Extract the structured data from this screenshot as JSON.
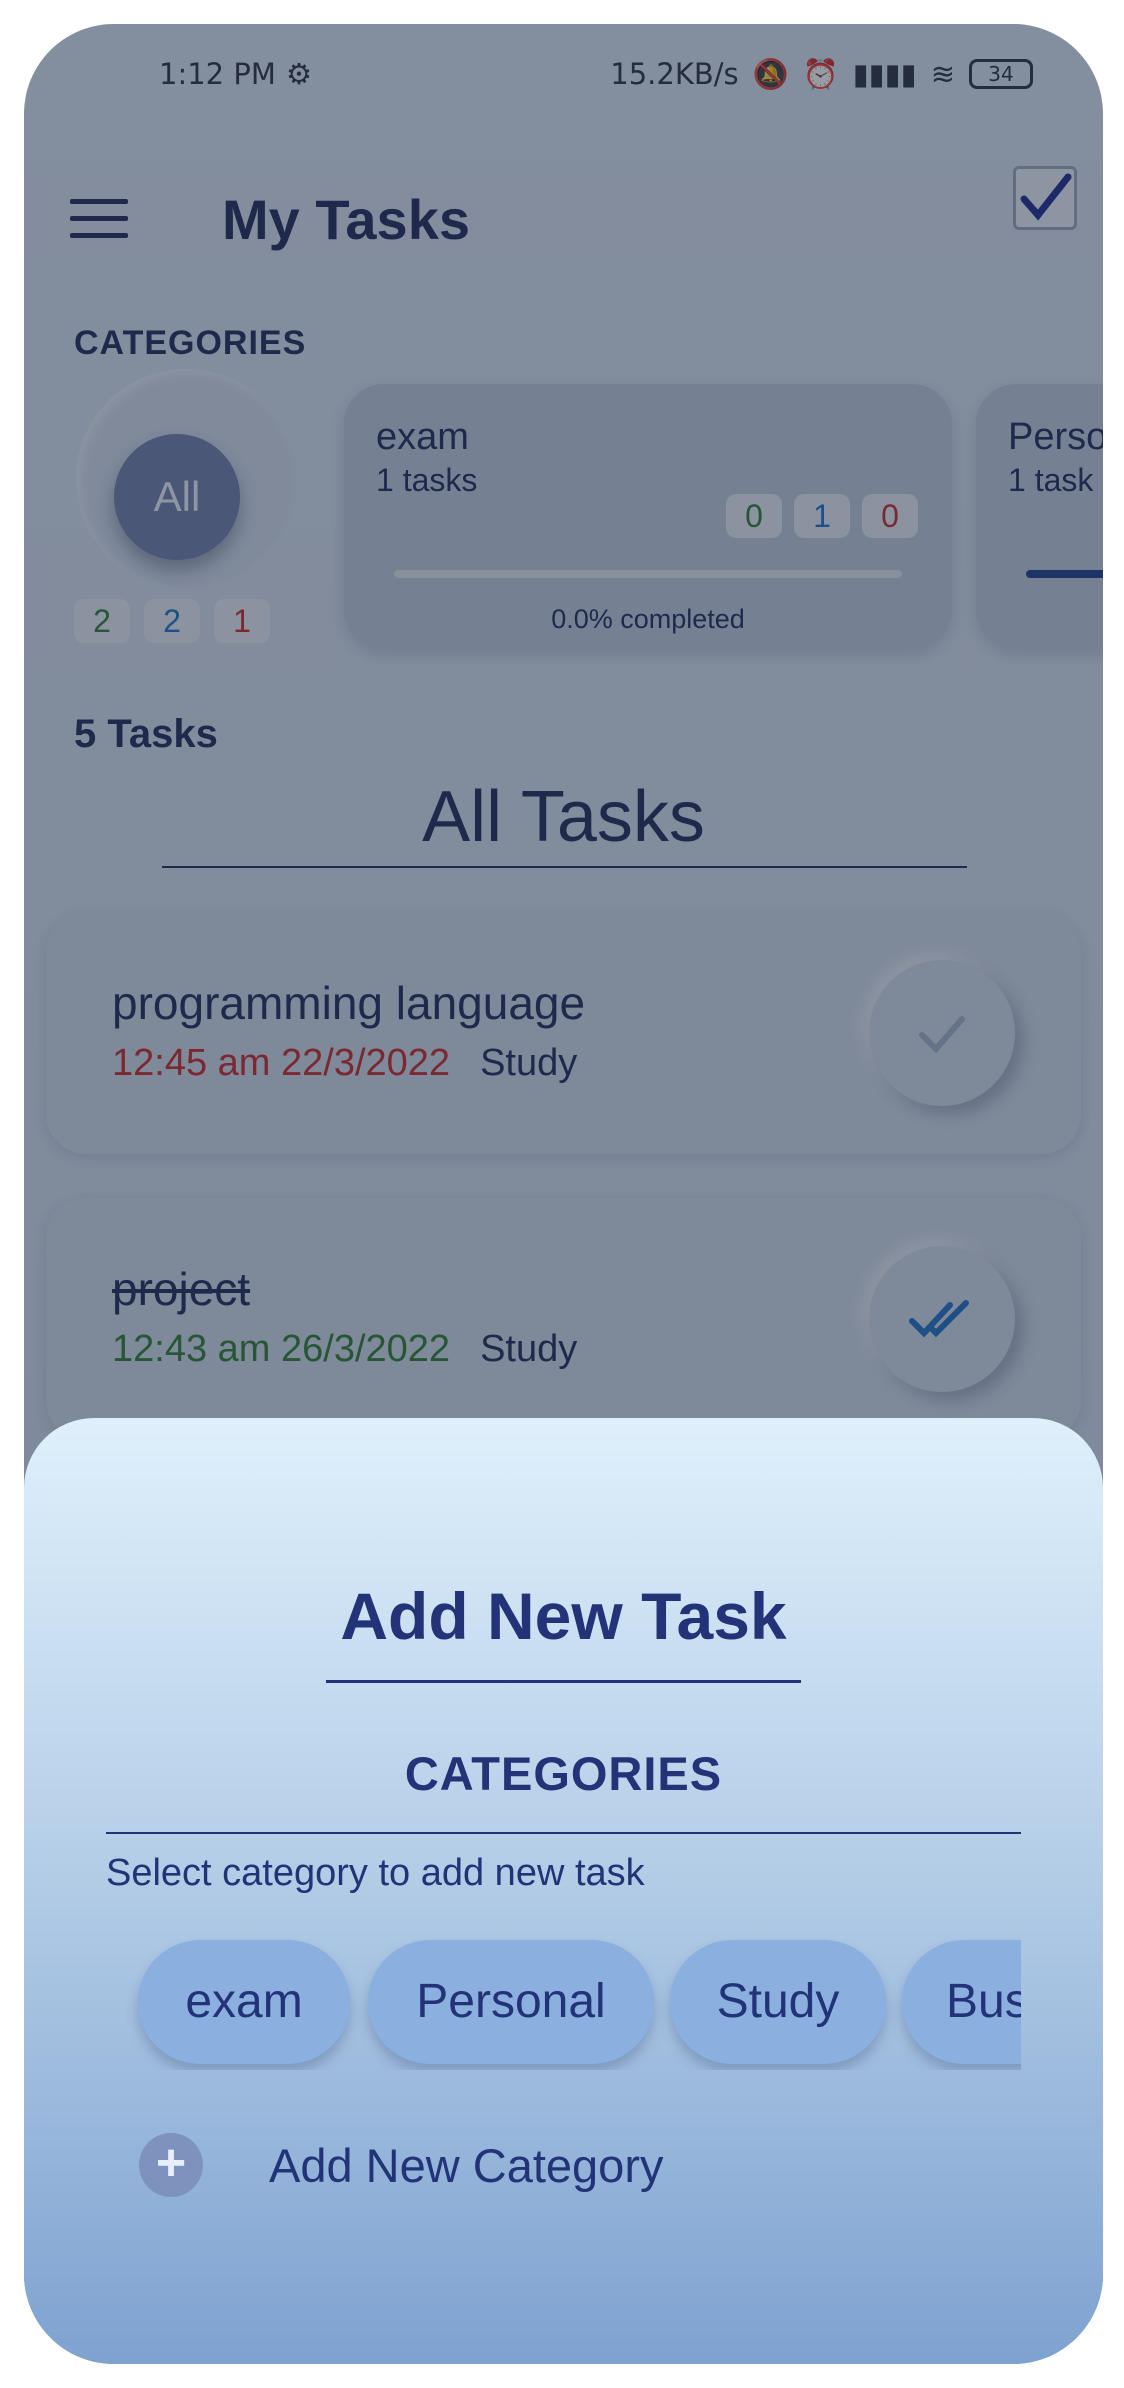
{
  "status": {
    "time": "1:12 PM",
    "network_speed": "15.2KB/s",
    "battery": "34"
  },
  "header": {
    "title": "My Tasks"
  },
  "categories": {
    "label": "CATEGORIES",
    "all_label": "All",
    "all_counts": {
      "green": "2",
      "blue": "2",
      "red": "1"
    },
    "cards": [
      {
        "name": "exam",
        "count": "1 tasks",
        "green": "0",
        "blue": "1",
        "red": "0",
        "progress_pct": 0,
        "completed": "0.0% completed"
      },
      {
        "name": "Perso",
        "count": "1 task"
      }
    ]
  },
  "tasks": {
    "count_label": "5 Tasks",
    "heading": "All Tasks",
    "items": [
      {
        "name": "programming language",
        "datetime": "12:45 am 22/3/2022",
        "category": "Study",
        "status": "pending"
      },
      {
        "name": "project",
        "datetime": "12:43 am 26/3/2022",
        "category": "Study",
        "status": "done"
      }
    ]
  },
  "sheet": {
    "title": "Add New Task",
    "categories_label": "CATEGORIES",
    "hint": "Select category to add new task",
    "chips": [
      "exam",
      "Personal",
      "Study",
      "Busi"
    ],
    "add_category": "Add New Category"
  },
  "colors": {
    "primary": "#223377",
    "overdue": "#c62828",
    "ontime": "#2e7d32"
  }
}
